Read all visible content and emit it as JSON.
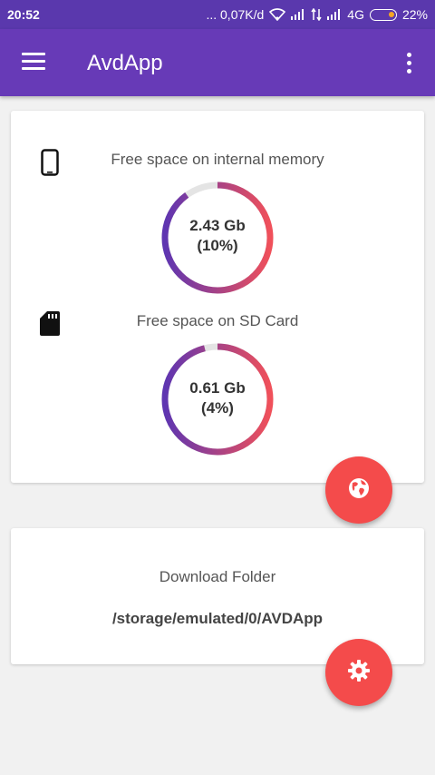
{
  "status_bar": {
    "time": "20:52",
    "network_speed": "... 0,07K/d",
    "network_type": "4G",
    "battery": "22%"
  },
  "app_bar": {
    "title": "AvdApp"
  },
  "storage": {
    "internal": {
      "label": "Free space on internal memory",
      "value": "2.43 Gb",
      "percent_text": "(10%)",
      "free_fraction": 0.1
    },
    "sd_card": {
      "label": "Free space on SD Card",
      "value": "0.61 Gb",
      "percent_text": "(4%)",
      "free_fraction": 0.04
    }
  },
  "download": {
    "label": "Download Folder",
    "path": "/storage/emulated/0/AVDApp"
  },
  "colors": {
    "primary": "#673ab7",
    "status_bar": "#5a38ad",
    "accent": "#f44b4b",
    "ring_start": "#5e35b1",
    "ring_end": "#f0505a",
    "ring_track": "#e4e4e4"
  },
  "icons": {
    "menu": "hamburger-menu-icon",
    "more": "more-vertical-icon",
    "phone": "smartphone-icon",
    "sd_card": "sd-card-icon",
    "globe": "globe-icon",
    "settings": "gear-icon"
  }
}
